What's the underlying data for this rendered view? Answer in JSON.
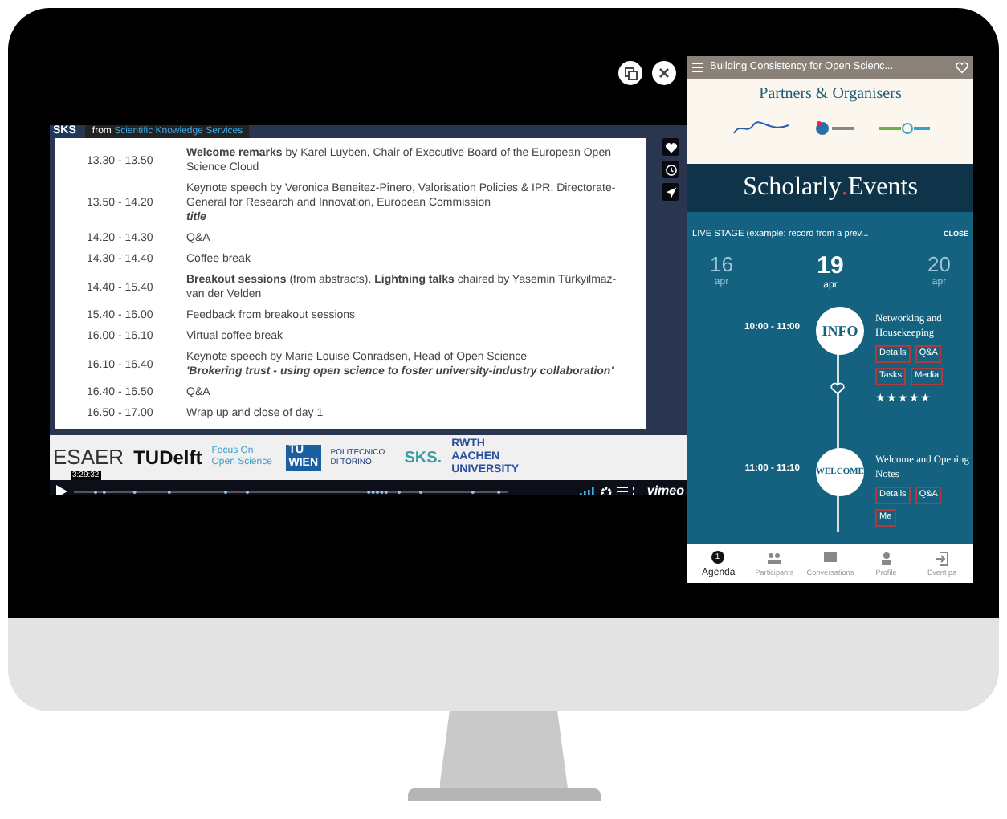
{
  "video": {
    "source_badge": {
      "prefix": "from",
      "name": "Scientific Knowledge Services"
    },
    "logo_corner": "SKS",
    "schedule": [
      {
        "time": "13.30 - 13.50",
        "text": "**Welcome remarks** by Karel Luyben, Chair of Executive Board of the European Open Science Cloud"
      },
      {
        "time": "13.50 - 14.20",
        "text": "Keynote speech by Veronica Beneitez-Pinero, Valorisation Policies & IPR, Directorate-General for Research and Innovation, European Commission",
        "note": "title"
      },
      {
        "time": "14.20 - 14.30",
        "text": "Q&A"
      },
      {
        "time": "14.30 - 14.40",
        "text": "Coffee break"
      },
      {
        "time": "14.40 - 15.40",
        "text": "**Breakout sessions** (from abstracts). **Lightning talks** chaired by Yasemin Türkyilmaz-van der Velden"
      },
      {
        "time": "15.40 - 16.00",
        "text": "Feedback from breakout sessions"
      },
      {
        "time": "16.00 - 16.10",
        "text": "Virtual coffee break"
      },
      {
        "time": "16.10 - 16.40",
        "text": "Keynote speech by Marie Louise Conradsen, Head of Open Science",
        "note": "'Brokering trust - using open science to foster university-industry collaboration'"
      },
      {
        "time": "16.40 - 16.50",
        "text": "Q&A"
      },
      {
        "time": "16.50 - 17.00",
        "text": "Wrap up and close of day 1"
      }
    ],
    "logos": [
      "ESAER",
      "TUDelft",
      "Focus On Open Science",
      "TU WIEN",
      "POLITECNICO DI TORINO",
      "SKS.",
      "RWTH AACHEN UNIVERSITY"
    ],
    "time_tooltip": "3:29:32",
    "brand": "vimeo"
  },
  "app": {
    "title": "Building Consistency for Open Scienc...",
    "partners_heading": "Partners & Organisers",
    "banner": {
      "name": "Scholarly",
      "dot": ".",
      "suffix": "Events"
    },
    "live": {
      "label": "LIVE STAGE (example: record from a prev...",
      "close": "CLOSE"
    },
    "dates": [
      {
        "day": "16",
        "month": "apr",
        "selected": false
      },
      {
        "day": "19",
        "month": "apr",
        "selected": true
      },
      {
        "day": "20",
        "month": "apr",
        "selected": false
      }
    ],
    "events": [
      {
        "time": "10:00 - 11:00",
        "badge": "INFO",
        "title": "Networking and Housekeeping",
        "actions": [
          "Details",
          "Q&A",
          "Tasks",
          "Media"
        ],
        "stars": 5
      },
      {
        "time": "11:00 - 11:10",
        "badge": "WELCOME",
        "title": "Welcome and Opening Notes",
        "actions": [
          "Details",
          "Q&A",
          "Me"
        ]
      }
    ],
    "nav": [
      {
        "label": "Agenda",
        "selected": true,
        "count": "1"
      },
      {
        "label": "Participants",
        "selected": false
      },
      {
        "label": "Conversations",
        "selected": false
      },
      {
        "label": "Profile",
        "selected": false
      },
      {
        "label": "Event pa",
        "selected": false
      }
    ]
  }
}
